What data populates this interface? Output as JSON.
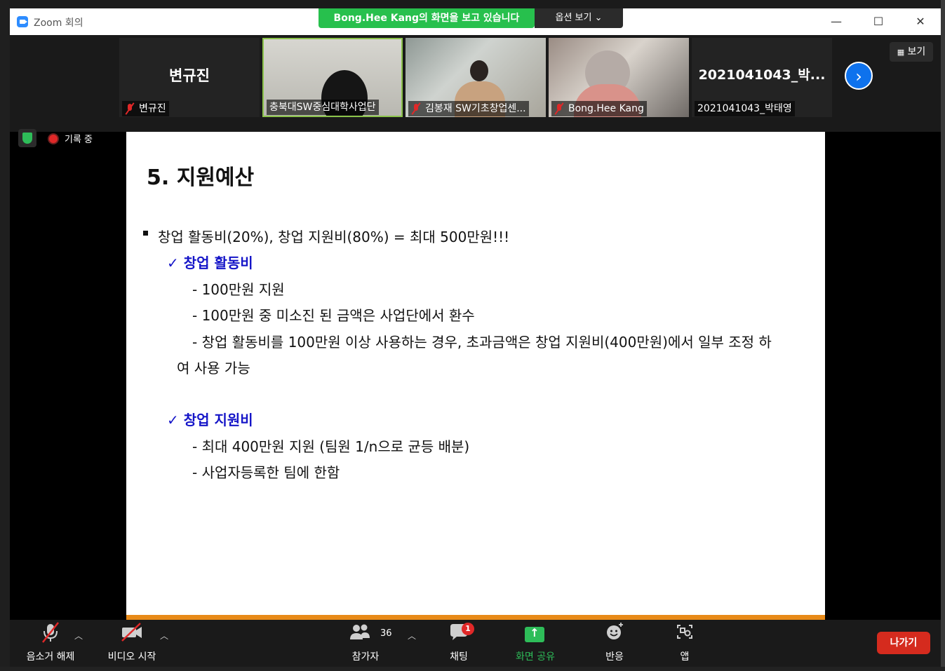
{
  "window": {
    "title": "Zoom 회의"
  },
  "banner": {
    "viewing": "Bong.Hee Kang의 화면을 보고 있습니다",
    "options": "옵션 보기 ⌄"
  },
  "participants": [
    {
      "big_name": "변규진",
      "name": "변규진",
      "muted": true
    },
    {
      "name": "충북대SW중심대학사업단",
      "muted": false
    },
    {
      "name": "김봉재 SW기초창업센...",
      "muted": true
    },
    {
      "name": "Bong.Hee Kang",
      "muted": true
    },
    {
      "big_name": "2021041043_박...",
      "name": "2021041043_박태영",
      "muted": false
    }
  ],
  "view_button": "보기",
  "recording": {
    "label": "기록 중"
  },
  "slide": {
    "title": "5. 지원예산",
    "bullet": "창업 활동비(20%), 창업 지원비(80%) = 최대 500만원!!!",
    "section1": {
      "heading": "✓ 창업 활동비",
      "lines": [
        "- 100만원 지원",
        "- 100만원 중 미소진 된 금액은 사업단에서 환수",
        "- 창업 활동비를 100만원 이상 사용하는 경우, 초과금액은 창업 지원비(400만원)에서 일부 조정 하",
        "여  사용 가능"
      ]
    },
    "section2": {
      "heading": "✓ 창업 지원비",
      "lines": [
        "- 최대 400만원 지원 (팀원 1/n으로 균등 배분)",
        "- 사업자등록한 팀에 한함"
      ]
    }
  },
  "toolbar": {
    "unmute": "음소거 해제",
    "start_video": "비디오 시작",
    "participants": "참가자",
    "participant_count": "36",
    "chat": "채팅",
    "chat_badge": "1",
    "share_screen": "화면 공유",
    "reactions": "반응",
    "apps": "앱",
    "leave": "나가기"
  },
  "colors": {
    "accent": "#2d8cff",
    "share_green": "#2ebd59",
    "leave_red": "#d52b1e",
    "heading_blue": "#1515c8",
    "slide_orange": "#e88a18"
  }
}
